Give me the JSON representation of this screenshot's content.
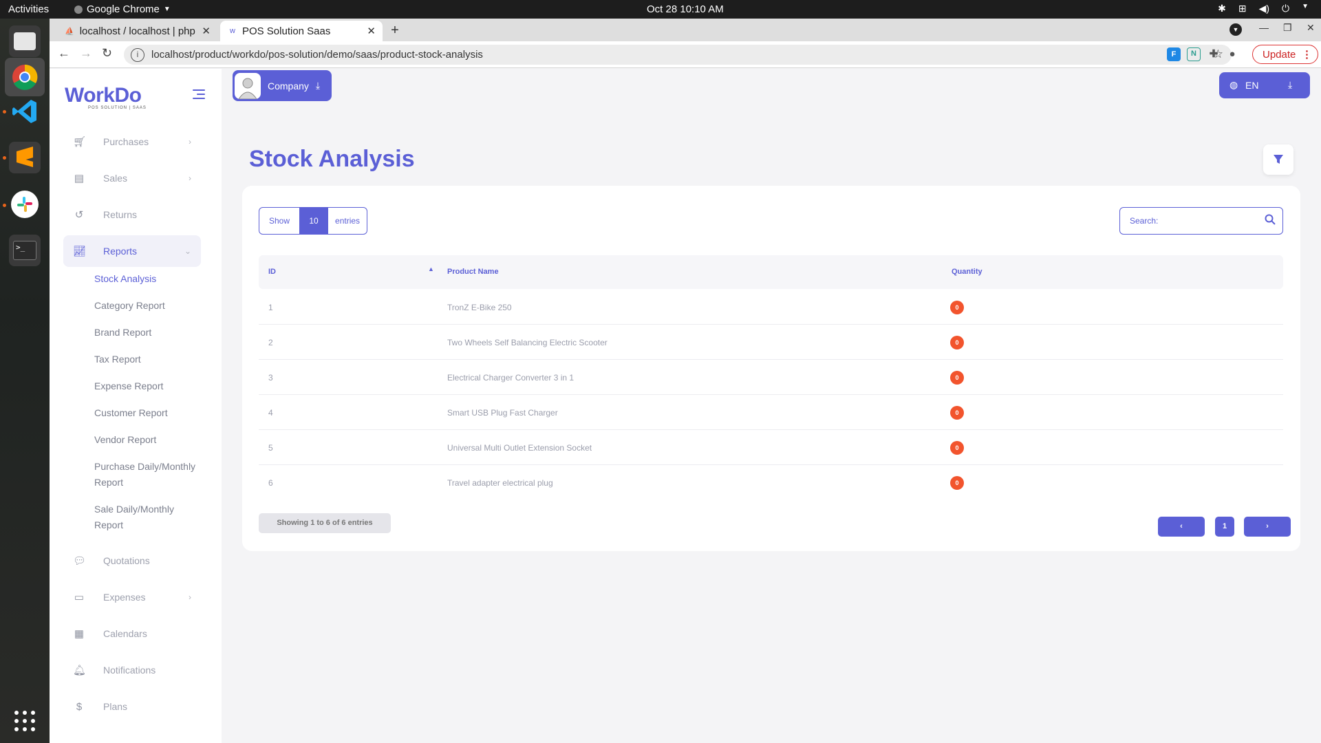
{
  "system": {
    "activities": "Activities",
    "app_name": "Google Chrome",
    "datetime": "Oct 28  10:10 AM"
  },
  "browser": {
    "tabs": [
      {
        "title": "localhost / localhost | php"
      },
      {
        "title": "POS Solution Saas"
      }
    ],
    "url": "localhost/product/workdo/pos-solution/demo/saas/product-stock-analysis",
    "update_label": "Update"
  },
  "app": {
    "logo_text": "WorkDo",
    "logo_sub": "POS SOLUTION | SAAS",
    "company_label": "Company",
    "lang_label": "EN",
    "page_title": "Stock Analysis",
    "nav": [
      {
        "label": "Purchases",
        "icon": "cart-icon",
        "chevron": true
      },
      {
        "label": "Sales",
        "icon": "receipt-icon",
        "chevron": true
      },
      {
        "label": "Returns",
        "icon": "undo-icon",
        "chevron": false
      },
      {
        "label": "Reports",
        "icon": "chart-icon",
        "chevron": true,
        "active": true
      },
      {
        "label": "Quotations",
        "icon": "chat-icon",
        "chevron": false
      },
      {
        "label": "Expenses",
        "icon": "money-icon",
        "chevron": true
      },
      {
        "label": "Calendars",
        "icon": "calendar-icon",
        "chevron": false
      },
      {
        "label": "Notifications",
        "icon": "bell-icon",
        "chevron": false
      },
      {
        "label": "Plans",
        "icon": "dollar-icon",
        "chevron": false
      }
    ],
    "reports_sub": [
      {
        "label": "Stock Analysis",
        "active": true
      },
      {
        "label": "Category Report"
      },
      {
        "label": "Brand Report"
      },
      {
        "label": "Tax Report"
      },
      {
        "label": "Expense Report"
      },
      {
        "label": "Customer Report"
      },
      {
        "label": "Vendor Report"
      },
      {
        "label": "Purchase Daily/Monthly Report"
      },
      {
        "label": "Sale Daily/Monthly Report"
      }
    ],
    "table": {
      "show_label": "Show",
      "page_size": "10",
      "entries_label": "entries",
      "search_label": "Search:",
      "columns": [
        "ID",
        "Product Name",
        "Quantity"
      ],
      "rows": [
        {
          "id": "1",
          "name": "TronZ E-Bike 250",
          "qty": "0"
        },
        {
          "id": "2",
          "name": "Two Wheels Self Balancing Electric Scooter",
          "qty": "0"
        },
        {
          "id": "3",
          "name": "Electrical Charger Converter 3 in 1",
          "qty": "0"
        },
        {
          "id": "4",
          "name": "Smart USB Plug Fast Charger",
          "qty": "0"
        },
        {
          "id": "5",
          "name": "Universal Multi Outlet Extension Socket",
          "qty": "0"
        },
        {
          "id": "6",
          "name": "Travel adapter electrical plug",
          "qty": "0"
        }
      ],
      "info": "Showing 1 to 6 of 6 entries",
      "prev": "‹",
      "page": "1",
      "next": "›"
    }
  },
  "colors": {
    "accent": "#5b5fd6",
    "badge": "#f2542d"
  }
}
